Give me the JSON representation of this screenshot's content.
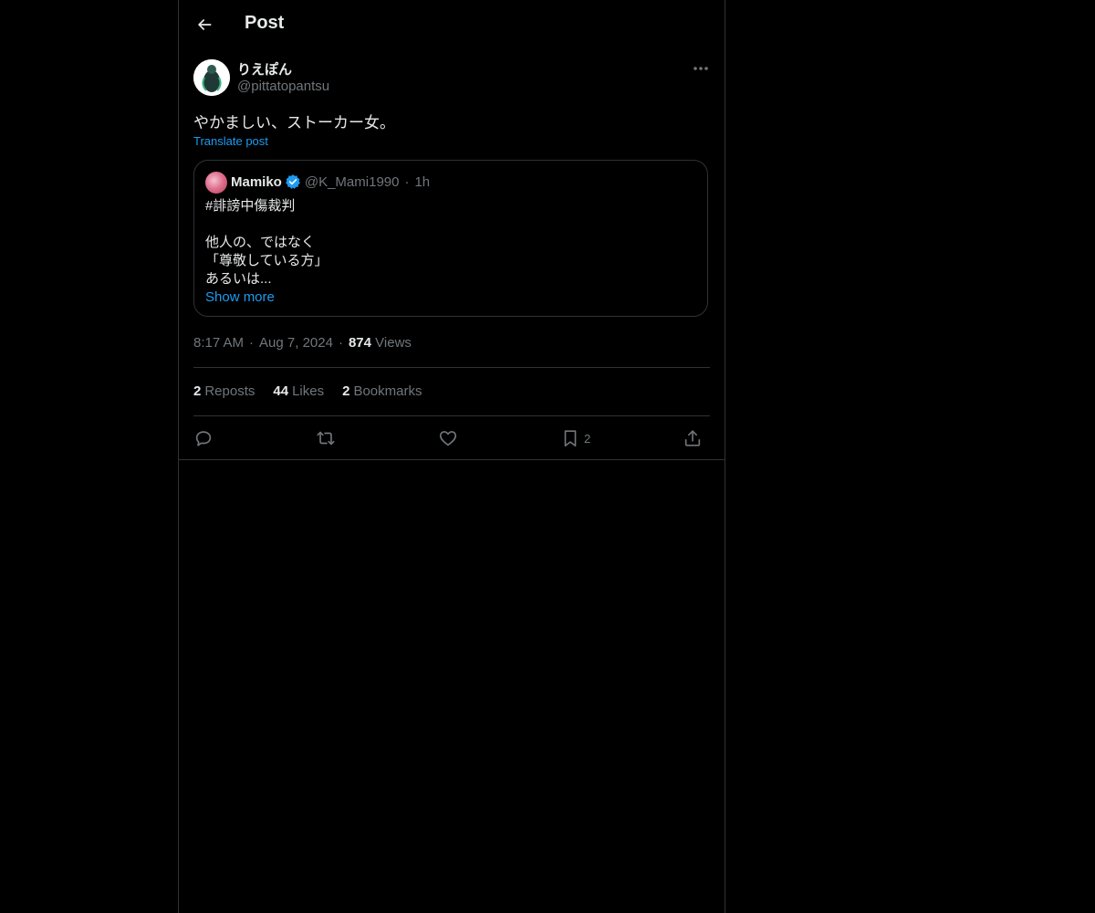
{
  "header": {
    "title": "Post",
    "back_icon": "arrow-left-icon"
  },
  "post": {
    "author": {
      "name": "りえぽん",
      "handle": "@pittatopantsu"
    },
    "text": "やかましい、ストーカー女。",
    "translate_label": "Translate post",
    "quote": {
      "name": "Mamiko",
      "verified": true,
      "handle": "@K_Mami1990",
      "time": "1h",
      "lines": [
        "#誹謗中傷裁判",
        "",
        "他人の、ではなく",
        "「尊敬している方」",
        "あるいは..."
      ],
      "show_more": "Show more"
    },
    "meta": {
      "time": "8:17 AM",
      "date": "Aug 7, 2024",
      "views_count": "874",
      "views_label": "Views"
    },
    "stats": {
      "reposts_count": "2",
      "reposts_label": "Reposts",
      "likes_count": "44",
      "likes_label": "Likes",
      "bookmarks_count": "2",
      "bookmarks_label": "Bookmarks"
    },
    "actions": {
      "bookmark_count": "2"
    }
  },
  "colors": {
    "background": "#000000",
    "text": "#e7e9ea",
    "muted": "#71767b",
    "accent": "#1d9bf0",
    "border": "#2f3336"
  }
}
